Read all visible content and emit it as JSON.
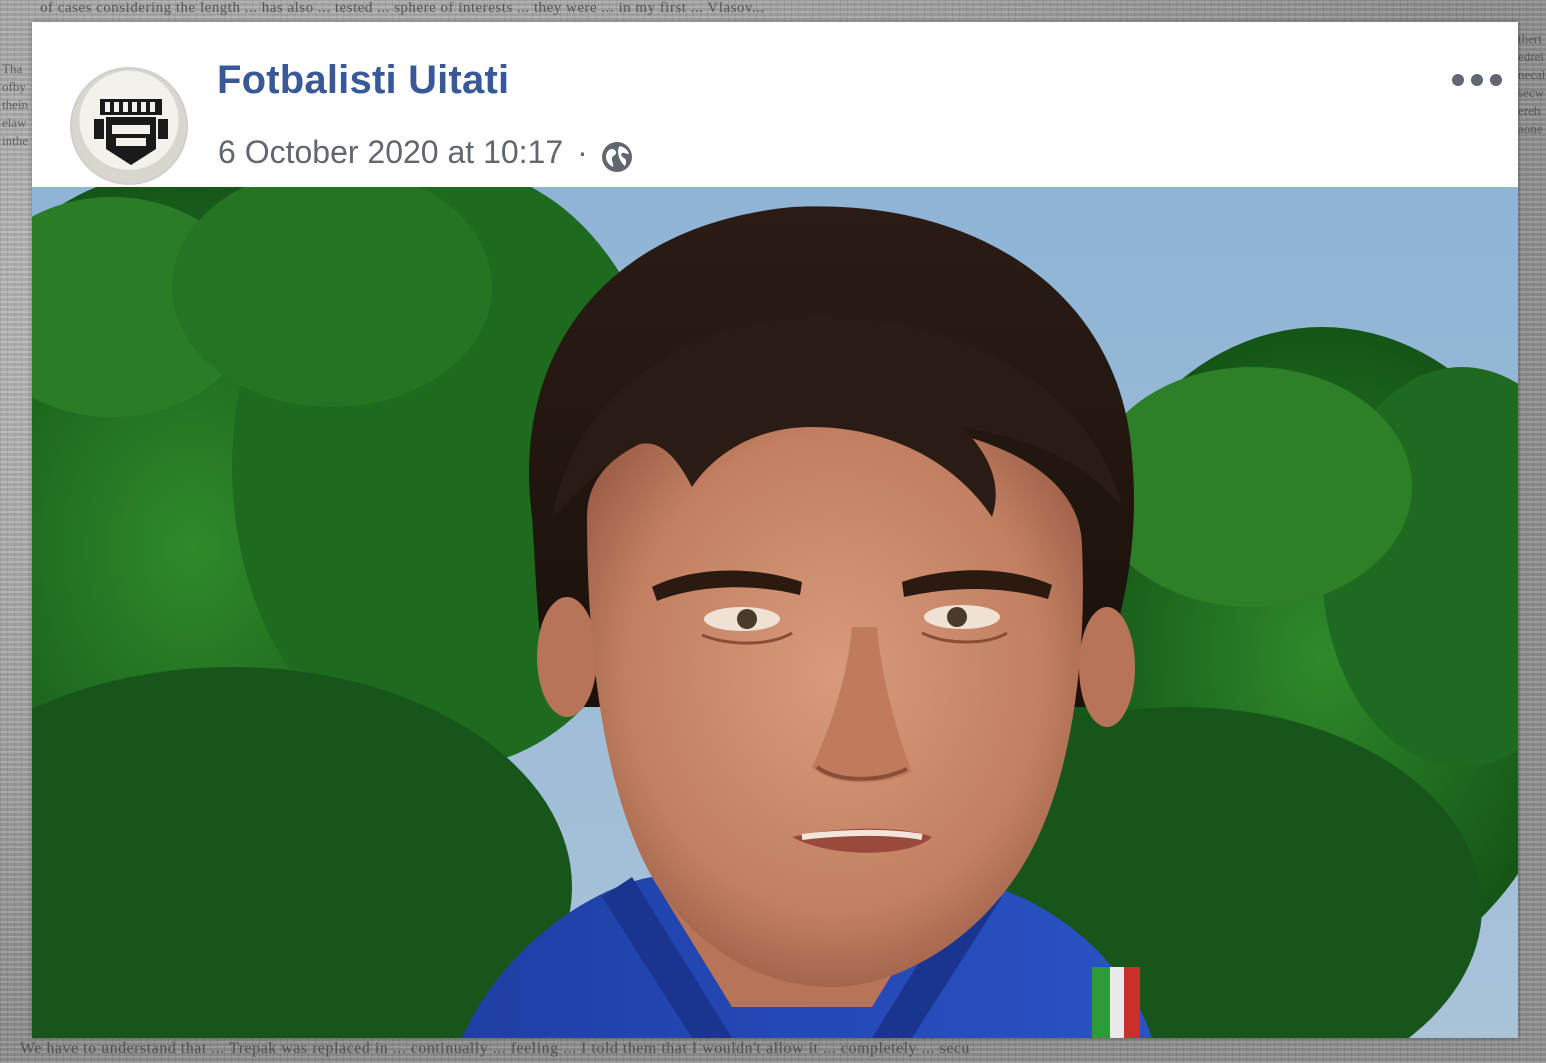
{
  "post": {
    "page_name": "Fotbalisti Uitati",
    "timestamp": "6 October 2020 at 10:17",
    "separator": "·",
    "privacy_icon": "globe-icon",
    "menu_icon": "more-horizontal-icon",
    "avatar_icon": "fotbalisti-uitati-logo",
    "photo_subject": "photo"
  },
  "background": {
    "top_text": "of cases considering the length ... has also ... tested ... sphere of interests ... they were ... in my first ... Vlasov...",
    "bottom_text": "We have to understand that ... Trepak was replaced in ... continually ... feeling ... I told them that I wouldn't allow it ... completely ... secu",
    "left_text": "Thaofbytheinelawinthe",
    "right_text": "thertedreinecalsecwerehaone"
  },
  "colors": {
    "name": "#385898",
    "meta": "#616770",
    "card": "#ffffff"
  }
}
